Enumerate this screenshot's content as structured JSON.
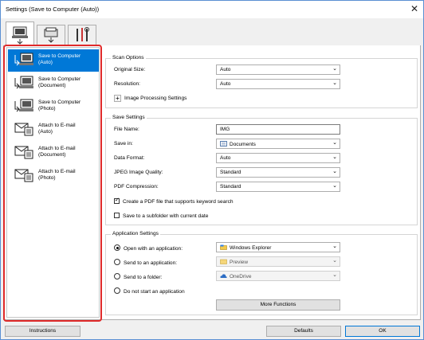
{
  "window": {
    "title": "Settings (Save to Computer (Auto))",
    "close_glyph": "✕"
  },
  "tabs": [
    {
      "icon": "scan-from-computer-icon"
    },
    {
      "icon": "scan-from-panel-icon"
    },
    {
      "icon": "general-settings-tools-icon"
    }
  ],
  "sidebar": {
    "items": [
      {
        "line1": "Save to Computer",
        "line2": "(Auto)",
        "icon": "save-to-computer-icon",
        "selected": true
      },
      {
        "line1": "Save to Computer",
        "line2": "(Document)",
        "icon": "save-to-computer-icon"
      },
      {
        "line1": "Save to Computer",
        "line2": "(Photo)",
        "icon": "save-to-computer-icon"
      },
      {
        "line1": "Attach to E-mail",
        "line2": "(Auto)",
        "icon": "attach-to-email-icon"
      },
      {
        "line1": "Attach to E-mail",
        "line2": "(Document)",
        "icon": "attach-to-email-icon"
      },
      {
        "line1": "Attach to E-mail",
        "line2": "(Photo)",
        "icon": "attach-to-email-icon"
      }
    ]
  },
  "scan_options": {
    "title": "Scan Options",
    "original_size_label": "Original Size:",
    "original_size_value": "Auto",
    "resolution_label": "Resolution:",
    "resolution_value": "Auto",
    "image_processing_label": "Image Processing Settings",
    "plus": "+"
  },
  "save_settings": {
    "title": "Save Settings",
    "file_name_label": "File Name:",
    "file_name_value": "IMG",
    "save_in_label": "Save in:",
    "save_in_value": "Documents",
    "data_format_label": "Data Format:",
    "data_format_value": "Auto",
    "jpeg_quality_label": "JPEG Image Quality:",
    "jpeg_quality_value": "Standard",
    "pdf_compression_label": "PDF Compression:",
    "pdf_compression_value": "Standard",
    "keyword_search_label": "Create a PDF file that supports keyword search",
    "keyword_search_checked": true,
    "subfolder_label": "Save to a subfolder with current date",
    "subfolder_checked": false
  },
  "application_settings": {
    "title": "Application Settings",
    "open_with_label": "Open with an application:",
    "open_with_value": "Windows Explorer",
    "send_to_app_label": "Send to an application:",
    "send_to_app_value": "Preview",
    "send_to_folder_label": "Send to a folder:",
    "send_to_folder_value": "OneDrive",
    "do_not_start_label": "Do not start an application",
    "more_functions_label": "More Functions",
    "selected_option": "open_with"
  },
  "footer": {
    "instructions_label": "Instructions",
    "defaults_label": "Defaults",
    "ok_label": "OK"
  },
  "colors": {
    "selection": "#0078d7",
    "highlight_box": "#e02a2a",
    "window_border": "#5a8fd3"
  }
}
